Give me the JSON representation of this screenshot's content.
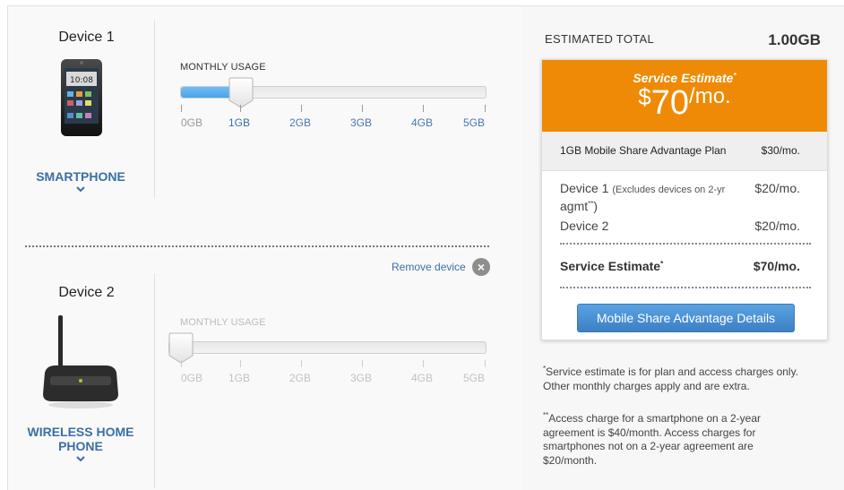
{
  "devices": [
    {
      "name": "Device 1",
      "type": "SMARTPHONE",
      "usage_label": "MONTHLY USAGE",
      "usage_gb": 1,
      "ticks": [
        "0GB",
        "1GB",
        "2GB",
        "3GB",
        "4GB",
        "5GB"
      ]
    },
    {
      "name": "Device 2",
      "type_line1": "WIRELESS HOME",
      "type_line2": "PHONE",
      "usage_label": "MONTHLY USAGE",
      "usage_gb": 0,
      "ticks": [
        "0GB",
        "1GB",
        "2GB",
        "3GB",
        "4GB",
        "5GB"
      ],
      "remove_label": "Remove device"
    }
  ],
  "summary": {
    "estimated_label": "ESTIMATED TOTAL",
    "estimated_value": "1.00GB",
    "card_title": "Service Estimate",
    "card_title_mark": "*",
    "price_dollar": "$",
    "price_amount": "70",
    "price_per": "/mo.",
    "plan_name": "1GB Mobile Share Advantage Plan",
    "plan_price": "$30/mo.",
    "line1_name": "Device 1",
    "line1_note": "(Excludes devices on 2-yr",
    "line1_note2": "agmt",
    "line1_note_mark": "**",
    "line1_note_close": ")",
    "line1_price": "$20/mo.",
    "line2_name": "Device 2",
    "line2_price": "$20/mo.",
    "total_label": "Service Estimate",
    "total_mark": "*",
    "total_price": "$70/mo.",
    "details_button": "Mobile Share Advantage Details"
  },
  "notes": {
    "note1_mark": "*",
    "note1": "Service estimate is for plan and access charges only. Other monthly charges apply and are extra.",
    "note2_mark": "**",
    "note2": "Access charge for a smartphone on a 2-year agreement is $40/month. Access charges for smartphones not on a 2-year agreement are $20/month."
  },
  "colors": {
    "accent_orange": "#ef8a06",
    "link_blue": "#3a6fa7",
    "slider_fill": "#4ba3e8"
  }
}
